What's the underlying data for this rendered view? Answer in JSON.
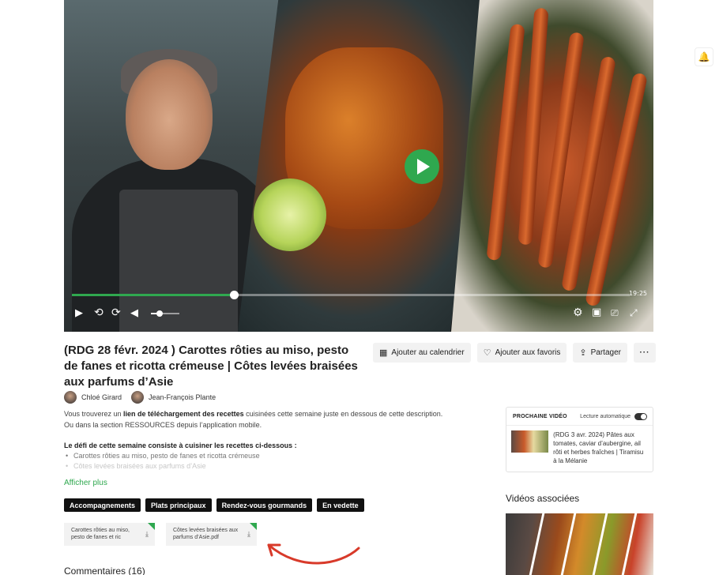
{
  "player": {
    "time_total": "19:25",
    "progress": 0.29,
    "volume": 0.3,
    "icons": {
      "play": "play-icon",
      "rewind": "rewind-10-icon",
      "forward": "forward-10-icon",
      "volume": "volume-icon",
      "settings": "gear-icon",
      "pip": "picture-in-picture-icon",
      "cast": "cast-icon",
      "fullscreen": "fullscreen-icon"
    },
    "accent": "#2fa84f"
  },
  "video": {
    "title_bold": "(RDG 28 févr. 2024 )",
    "title_rest": " Carottes rôties au miso, pesto de fanes et ricotta crémeuse | Côtes levées braisées aux parfums d’Asie"
  },
  "actions": {
    "calendar": "Ajouter au calendrier",
    "favorites": "Ajouter aux favoris",
    "share": "Partager",
    "more": "···"
  },
  "authors": [
    {
      "name": "Chloé Girard"
    },
    {
      "name": "Jean-François Plante"
    }
  ],
  "description": {
    "part1": "Vous trouverez un ",
    "bold": "lien de téléchargement des recettes",
    "part2": " cuisinées cette semaine juste en dessous de cette description. Ou dans la section RESSOURCES depuis l’application mobile."
  },
  "challenge": {
    "heading": "Le défi de cette semaine consiste à cuisiner les recettes ci-dessous :",
    "items": [
      "Carottes rôties au miso, pesto de fanes et ricotta crémeuse",
      "Côtes levées braisées aux parfums d’Asie"
    ]
  },
  "show_more": "Afficher plus",
  "tags": [
    "Accompagnements",
    "Plats principaux",
    "Rendez-vous gourmands",
    "En vedette"
  ],
  "files": [
    {
      "name": "Carottes rôties au miso, pesto de fanes et ric"
    },
    {
      "name": "Côtes levées braisées aux parfums d’Asie.pdf"
    }
  ],
  "comments_label": "Commentaires (16)",
  "next_video": {
    "label": "PROCHAINE VIDÉO",
    "autoplay_label": "Lecture automatique",
    "title": "(RDG 3 avr. 2024) Pâtes aux tomates, caviar d’aubergine, ail rôti et herbes fraîches | Tiramisu à la Mélanie"
  },
  "related_title": "Vidéos associées"
}
